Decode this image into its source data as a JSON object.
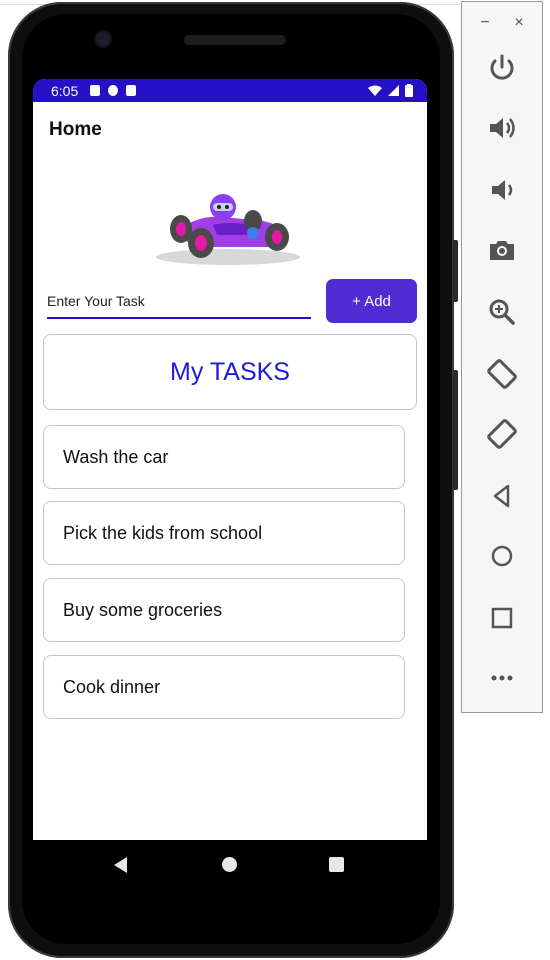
{
  "status_bar": {
    "time": "6:05"
  },
  "app": {
    "title": "Home"
  },
  "task_input": {
    "placeholder": "Enter Your Task"
  },
  "add_button": {
    "label": "+ Add"
  },
  "tasks_header": {
    "label": "My TASKS"
  },
  "tasks": [
    {
      "label": "Wash the car"
    },
    {
      "label": "Pick the kids from school"
    },
    {
      "label": "Buy some groceries"
    },
    {
      "label": "Cook dinner"
    }
  ],
  "window_controls": {
    "minimize": "−",
    "close": "×"
  },
  "toolbar_icons": [
    "power-icon",
    "volume-up-icon",
    "volume-down-icon",
    "camera-icon",
    "zoom-icon",
    "rotate-left-icon",
    "rotate-right-icon",
    "back-icon",
    "home-icon",
    "overview-icon",
    "more-icon"
  ],
  "colors": {
    "status_bar": "#2510c8",
    "accent": "#512bd4",
    "header_text": "#1c1cd8"
  }
}
